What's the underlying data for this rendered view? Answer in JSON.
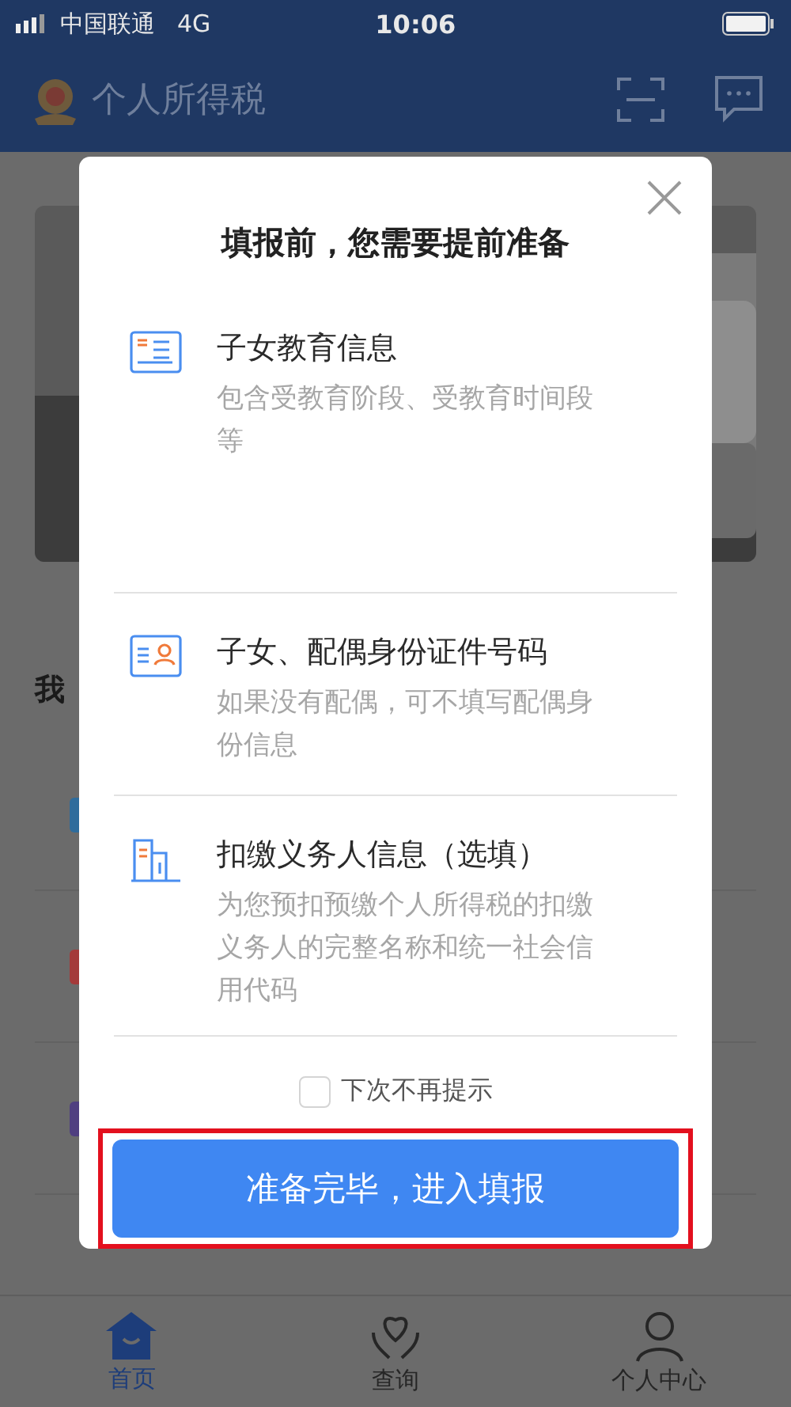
{
  "status_bar": {
    "carrier": "中国联通",
    "network": "4G",
    "time": "10:06"
  },
  "header": {
    "title": "个人所得税"
  },
  "page": {
    "section_title": "我"
  },
  "dialog": {
    "title": "填报前，您需要提前准备",
    "items": [
      {
        "kind": "education",
        "title": "子女教育信息",
        "description": "包含受教育阶段、受教育时间段等"
      },
      {
        "kind": "id",
        "title": "子女、配偶身份证件号码",
        "description": "如果没有配偶，可不填写配偶身份信息"
      },
      {
        "kind": "company",
        "title": "扣缴义务人信息（选填）",
        "description": "为您预扣预缴个人所得税的扣缴义务人的完整名称和统一社会信用代码"
      }
    ],
    "checkbox": {
      "label": "下次不再提示",
      "checked": false
    },
    "button": {
      "label": "准备完毕，进入填报",
      "highlighted": true
    }
  },
  "bottom_nav": [
    {
      "kind": "home",
      "label": "首页",
      "selected": true
    },
    {
      "kind": "query",
      "label": "查询",
      "selected": false
    },
    {
      "kind": "profile",
      "label": "个人中心",
      "selected": false
    }
  ]
}
